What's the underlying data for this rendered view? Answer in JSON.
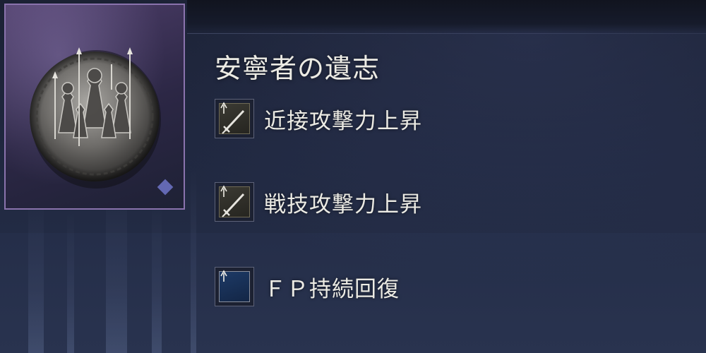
{
  "talisman": {
    "name": "安寧者の遺志",
    "icon": "medallion-icon"
  },
  "effects": [
    {
      "label": "近接攻撃力上昇",
      "icon": "sword-up-icon"
    },
    {
      "label": "戦技攻撃力上昇",
      "icon": "sword-up-icon"
    },
    {
      "label": "ＦＰ持続回復",
      "icon": "fp-up-icon"
    }
  ],
  "colors": {
    "frame_border": "#8a73ad",
    "text": "#ecebe4",
    "background": "#202840",
    "fp_blue": "#1d3a66"
  }
}
